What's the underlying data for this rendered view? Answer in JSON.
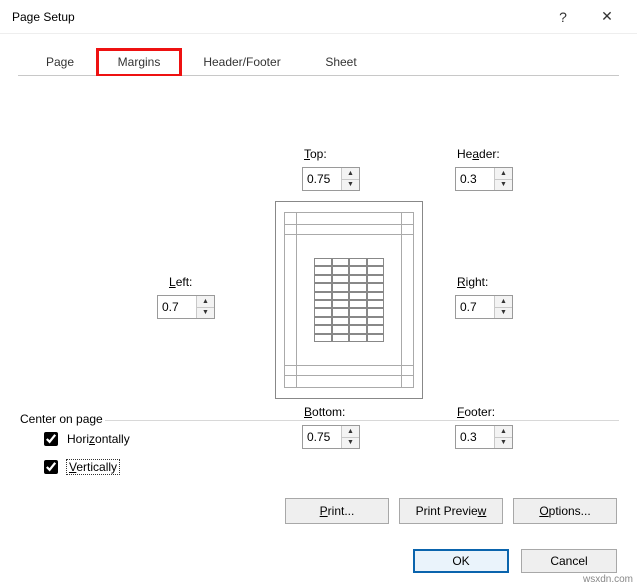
{
  "dialog": {
    "title": "Page Setup",
    "help_glyph": "?",
    "close_glyph": "✕"
  },
  "tabs": {
    "page": "Page",
    "margins": "Margins",
    "header_footer": "Header/Footer",
    "sheet": "Sheet"
  },
  "margins": {
    "top": {
      "label_pre": "",
      "label_u": "T",
      "label_post": "op:",
      "value": "0.75"
    },
    "header": {
      "label_pre": "He",
      "label_u": "a",
      "label_post": "der:",
      "value": "0.3"
    },
    "left": {
      "label_pre": "",
      "label_u": "L",
      "label_post": "eft:",
      "value": "0.7"
    },
    "right": {
      "label_pre": "",
      "label_u": "R",
      "label_post": "ight:",
      "value": "0.7"
    },
    "bottom": {
      "label_pre": "",
      "label_u": "B",
      "label_post": "ottom:",
      "value": "0.75"
    },
    "footer": {
      "label_pre": "",
      "label_u": "F",
      "label_post": "ooter:",
      "value": "0.3"
    }
  },
  "center": {
    "group_label": "Center on page",
    "horizontally": {
      "pre": "Hori",
      "u": "z",
      "post": "ontally",
      "checked": true
    },
    "vertically": {
      "pre": "",
      "u": "V",
      "post": "ertically",
      "checked": true
    }
  },
  "buttons": {
    "print": {
      "pre": "",
      "u": "P",
      "post": "rint..."
    },
    "preview": {
      "pre": "Print Previe",
      "u": "w",
      "post": ""
    },
    "options": {
      "pre": "",
      "u": "O",
      "post": "ptions..."
    },
    "ok": "OK",
    "cancel": "Cancel"
  },
  "watermark": "wsxdn.com"
}
